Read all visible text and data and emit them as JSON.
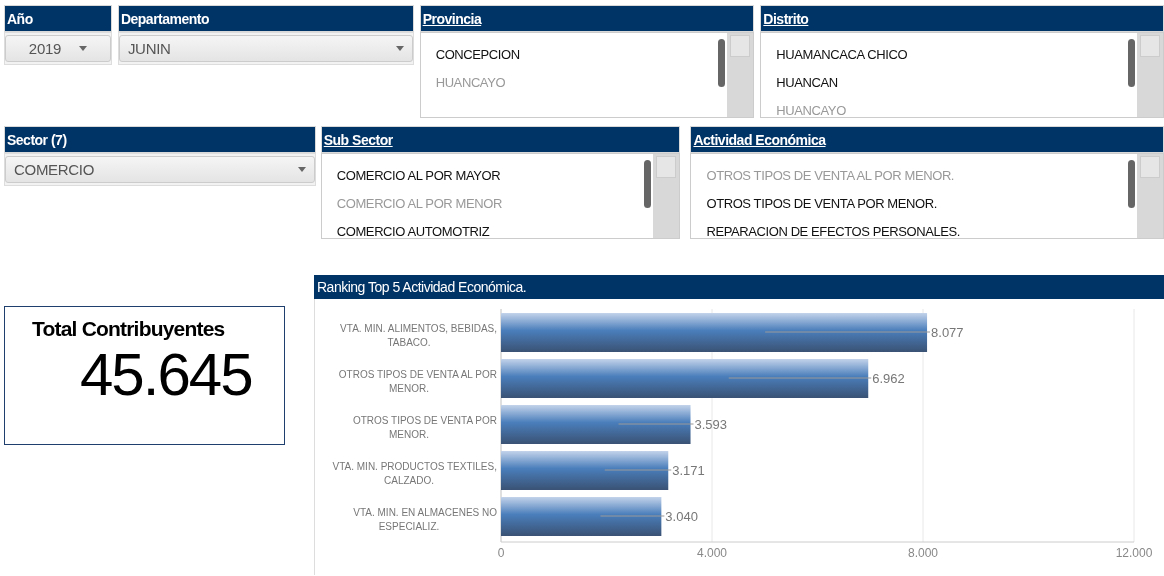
{
  "filters_row_1": [
    {
      "kind": "dropdown",
      "title": "Año",
      "underlined": false,
      "value": "2019"
    },
    {
      "kind": "dropdown",
      "title": "Departamento",
      "underlined": false,
      "value": "JUNIN"
    },
    {
      "kind": "list",
      "title": "Provincia",
      "underlined": true,
      "items": [
        {
          "label": "CONCEPCION",
          "selected": true
        },
        {
          "label": "HUANCAYO",
          "selected": false
        }
      ]
    },
    {
      "kind": "list",
      "title": "Distrito",
      "underlined": true,
      "items": [
        {
          "label": "HUAMANCACA CHICO",
          "selected": true
        },
        {
          "label": "HUANCAN",
          "selected": true
        },
        {
          "label": "HUANCAYO",
          "selected": false
        }
      ]
    }
  ],
  "filters_row_2": [
    {
      "kind": "dropdown",
      "title": "Sector (7)",
      "underlined": false,
      "value": "COMERCIO"
    },
    {
      "kind": "list",
      "title": "Sub Sector",
      "underlined": true,
      "items": [
        {
          "label": "COMERCIO AL POR MAYOR",
          "selected": true
        },
        {
          "label": "COMERCIO AL POR MENOR",
          "selected": false
        },
        {
          "label": "COMERCIO AUTOMOTRIZ",
          "selected": true
        }
      ]
    },
    {
      "kind": "list",
      "title": "Actividad Económica",
      "underlined": true,
      "items": [
        {
          "label": "OTROS TIPOS DE VENTA AL POR MENOR.",
          "selected": false
        },
        {
          "label": "OTROS TIPOS DE VENTA POR MENOR.",
          "selected": true
        },
        {
          "label": "REPARACION DE EFECTOS PERSONALES.",
          "selected": true
        }
      ]
    }
  ],
  "kpi": {
    "title": "Total Contribuyentes",
    "value": "45.645"
  },
  "ranking": {
    "title": "Ranking Top 5 Actividad Económica.",
    "chart_data": {
      "type": "bar",
      "orientation": "horizontal",
      "categories": [
        "VTA.  MIN. ALIMENTOS, BEBIDAS, TABACO.",
        "OTROS TIPOS DE VENTA AL POR MENOR.",
        "OTROS TIPOS DE VENTA POR MENOR.",
        "VTA. MIN. PRODUCTOS TEXTILES, CALZADO.",
        "VTA. MIN. EN ALMACENES NO ESPECIALIZ."
      ],
      "values": [
        8077,
        6962,
        3593,
        3171,
        3040
      ],
      "value_labels": [
        "8.077",
        "6.962",
        "3.593",
        "3.171",
        "3.040"
      ],
      "xlim": [
        0,
        12000
      ],
      "xticks": [
        {
          "value": 0,
          "label": "0"
        },
        {
          "value": 4000,
          "label": "4.000"
        },
        {
          "value": 8000,
          "label": "8.000"
        },
        {
          "value": 12000,
          "label": "12.000"
        }
      ]
    }
  }
}
